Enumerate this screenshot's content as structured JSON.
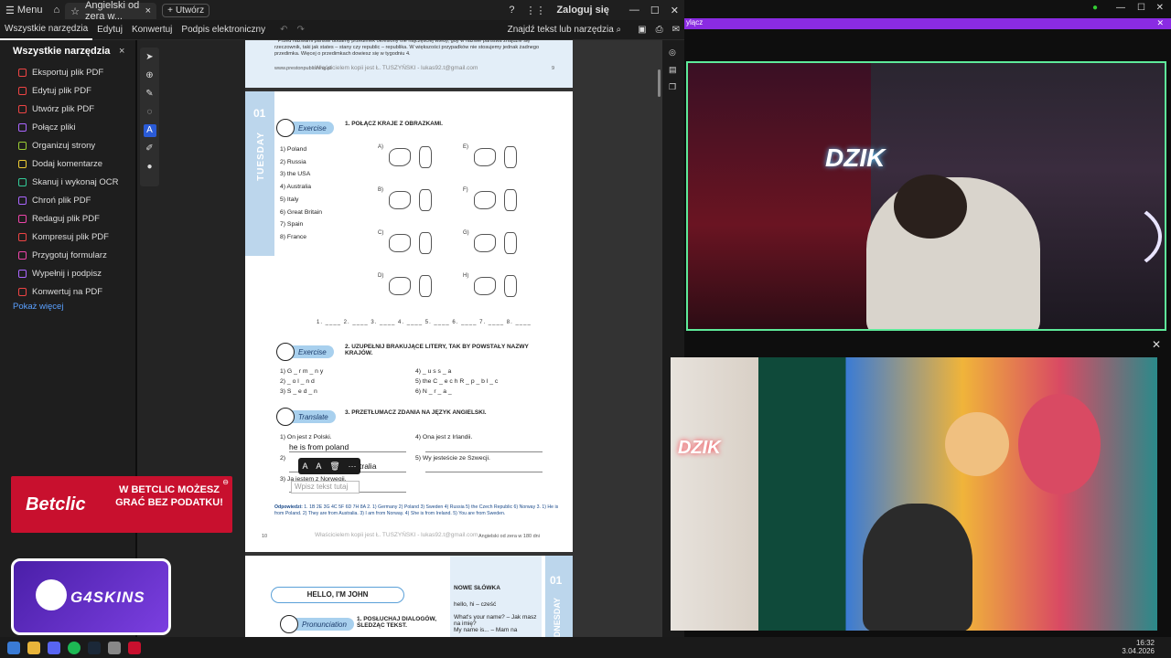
{
  "window": {
    "menu_label": "Menu",
    "tab_title": "Angielski od zera w...",
    "new_tab_label": "Utwórz",
    "login_label": "Zaloguj się"
  },
  "menubar": {
    "items": [
      "Wszystkie narzędzia",
      "Edytuj",
      "Konwertuj",
      "Podpis elektroniczny"
    ],
    "search_label": "Znajdź tekst lub narzędzia"
  },
  "sidepanel": {
    "title": "Wszystkie narzędzia",
    "tools": [
      "Eksportuj plik PDF",
      "Edytuj plik PDF",
      "Utwórz plik PDF",
      "Połącz pliki",
      "Organizuj strony",
      "Dodaj komentarze",
      "Skanuj i wykonaj OCR",
      "Chroń plik PDF",
      "Redaguj plik PDF",
      "Kompresuj plik PDF",
      "Przygotuj formularz",
      "Wypełnij i podpisz",
      "Konwertuj na PDF"
    ],
    "more_label": "Pokaż więcej"
  },
  "page_top": {
    "note": "* Przed nazwami państw dodamy przedimek określony the najczęściej wtedy, gdy w nazwie państwa znajdzie się rzeczownik, taki jak states – stany czy republic – republika. W większości przypadków nie stosujemy jednak żadnego przedimka. Więcej o przedimkach dowiesz się w tygodniu 4.",
    "footer_url": "www.prestonpublishing.pl",
    "watermark": "Właścicielem kopii jest Ł. TUSZYŃSKI - lukas92.t@gmail.com",
    "page_num": "9"
  },
  "page_main": {
    "day_num": "01",
    "day_name": "TUESDAY",
    "ex1_badge": "Exercise",
    "ex1_title": "1.  POŁĄCZ KRAJE Z OBRAZKAMI.",
    "countries": [
      "1)  Poland",
      "2)  Russia",
      "3)  the USA",
      "4)  Australia",
      "5)  Italy",
      "6)  Great Britain",
      "7)  Spain",
      "8)  France"
    ],
    "map_letters": [
      "A)",
      "B)",
      "C)",
      "D)",
      "E)",
      "F)",
      "G)",
      "H)"
    ],
    "blanks": "1. ____ 2. ____ 3. ____ 4. ____ 5. ____ 6. ____ 7. ____ 8. ____",
    "ex2_badge": "Exercise",
    "ex2_title": "2.  UZUPEŁNIJ BRAKUJĄCE LITERY, TAK BY POWSTAŁY NAZWY KRAJÓW.",
    "ex2_left": [
      "1)  G _ r m _ n y",
      "2)  _ o l _ n d",
      "3)  S _ e d _ n"
    ],
    "ex2_right": [
      "4)  _ u s s _ a",
      "5)  the C _ e c h  R _ p _ b l _ c",
      "6)  N _ r _ a _"
    ],
    "ex3_badge": "Translate",
    "ex3_title": "3.  PRZETŁUMACZ ZDANIA NA JĘZYK ANGIELSKI.",
    "ex3_items": [
      "1)  On jest z Polski.",
      "2)  ",
      "3)  Ja jestem z Norwegii."
    ],
    "ex3_right": [
      "4)  Ona jest z Irlandii.",
      "5)  Wy jesteście ze Szwecji."
    ],
    "typed_answer": "he is from poland",
    "typed_answer2": "tralia",
    "answers_label": "Odpowiedzi:",
    "answers": "1. 1B 2E 3G 4C 5F 6D 7H 8A  2. 1) Germany 2) Poland 3) Sweden 4) Russia 5) the Czech Republic 6) Norway  3. 1) He is from Poland. 2) They are from Australia. 3) I am from Norway. 4) She is from Ireland. 5) You are from Sweden.",
    "page_num": "10",
    "watermark": "Właścicielem kopii jest Ł. TUSZYŃSKI - lukas92.t@gmail.com",
    "book_title": "Angielski od zera w 180 dni"
  },
  "page_next": {
    "heading": "HELLO, I'M JOHN",
    "pron_badge": "Pronunciation",
    "pron_title": "1.  POSŁUCHAJ DIALOGÓW, ŚLEDZĄC TEKST.",
    "vocab_title": "NOWE SŁÓWKA",
    "vocab": [
      "hello, hi – cześć",
      "What's your name? – Jak masz na imię?",
      "My name is... – Mam na"
    ],
    "day_num": "01",
    "day_name": "WEDNESDAY"
  },
  "floatbar": {
    "text_tools": [
      "A",
      "A",
      "🗑",
      "···"
    ]
  },
  "textbox_placeholder": "Wpisz tekst tutaj",
  "ads": {
    "betclic_logo": "Betclic",
    "betclic_promo": "W BETCLIC MOŻESZ GRAĆ BEZ PODATKU!",
    "g4skins": "G4SKINS"
  },
  "stream": {
    "bar_label": "ylącz",
    "logo1": "DZIK",
    "logo2": "DZIK"
  },
  "clock": {
    "time": "16:32",
    "date": "3.04.2026"
  },
  "colors": {
    "accent_purple": "#8a2be2",
    "cam_border": "#5eea9a",
    "betclic_red": "#c8102e"
  }
}
